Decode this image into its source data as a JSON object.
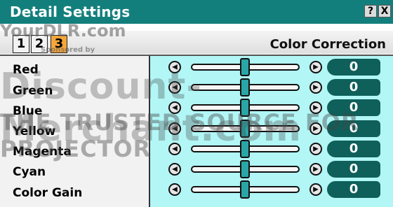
{
  "window": {
    "title": "Detail Settings",
    "help_label": "?",
    "close_label": "X"
  },
  "tabs": [
    {
      "label": "1",
      "active": false
    },
    {
      "label": "2",
      "active": false
    },
    {
      "label": "3",
      "active": true
    }
  ],
  "section": {
    "title": "Color Correction"
  },
  "rows": [
    {
      "label": "Red",
      "value": "0"
    },
    {
      "label": "Green",
      "value": "0"
    },
    {
      "label": "Blue",
      "value": "0"
    },
    {
      "label": "Yellow",
      "value": "0"
    },
    {
      "label": "Magenta",
      "value": "0"
    },
    {
      "label": "Cyan",
      "value": "0"
    },
    {
      "label": "Color Gain",
      "value": "0"
    }
  ],
  "watermarks": {
    "site": "YourDLR.com",
    "sponsored": "Sponsored by",
    "brand": "Discount-Merchant.com",
    "tagline": "THE TRUSTED SOURCE FOR PROJECTOR"
  },
  "colors": {
    "titlebar": "#137f7c",
    "panel": "#b2f6f6",
    "value_box": "#0f5f5a",
    "active_tab": "#f5a63a"
  }
}
